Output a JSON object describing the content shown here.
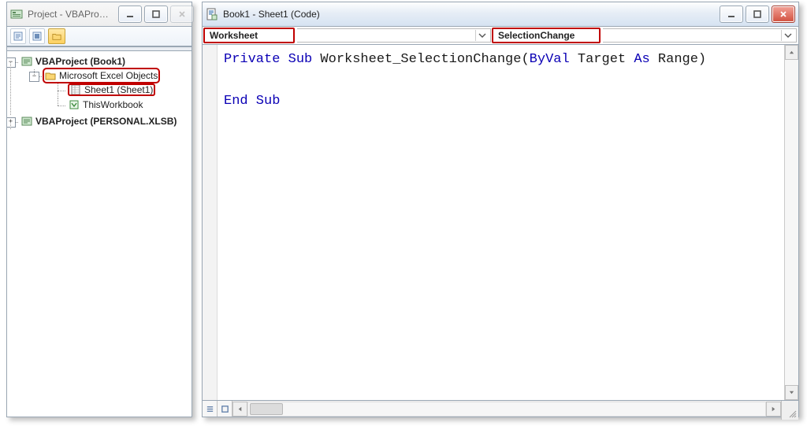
{
  "project_window": {
    "title": "Project - VBAPro…",
    "tree": {
      "root1": {
        "label": "VBAProject (Book1)",
        "folder_label": "Microsoft Excel Objects",
        "items": [
          {
            "label": "Sheet1 (Sheet1)"
          },
          {
            "label": "ThisWorkbook"
          }
        ]
      },
      "root2": {
        "label": "VBAProject (PERSONAL.XLSB)"
      }
    }
  },
  "code_window": {
    "title": "Book1 - Sheet1 (Code)",
    "object_dropdown": "Worksheet",
    "procedure_dropdown": "SelectionChange",
    "code": {
      "line1": {
        "pre": "Private Sub",
        "mid": " Worksheet_SelectionChange(",
        "byval": "ByVal",
        "mid2": " Target ",
        "as": "As",
        "post": " Range)"
      },
      "line_blank": "",
      "line3": "End Sub"
    }
  }
}
